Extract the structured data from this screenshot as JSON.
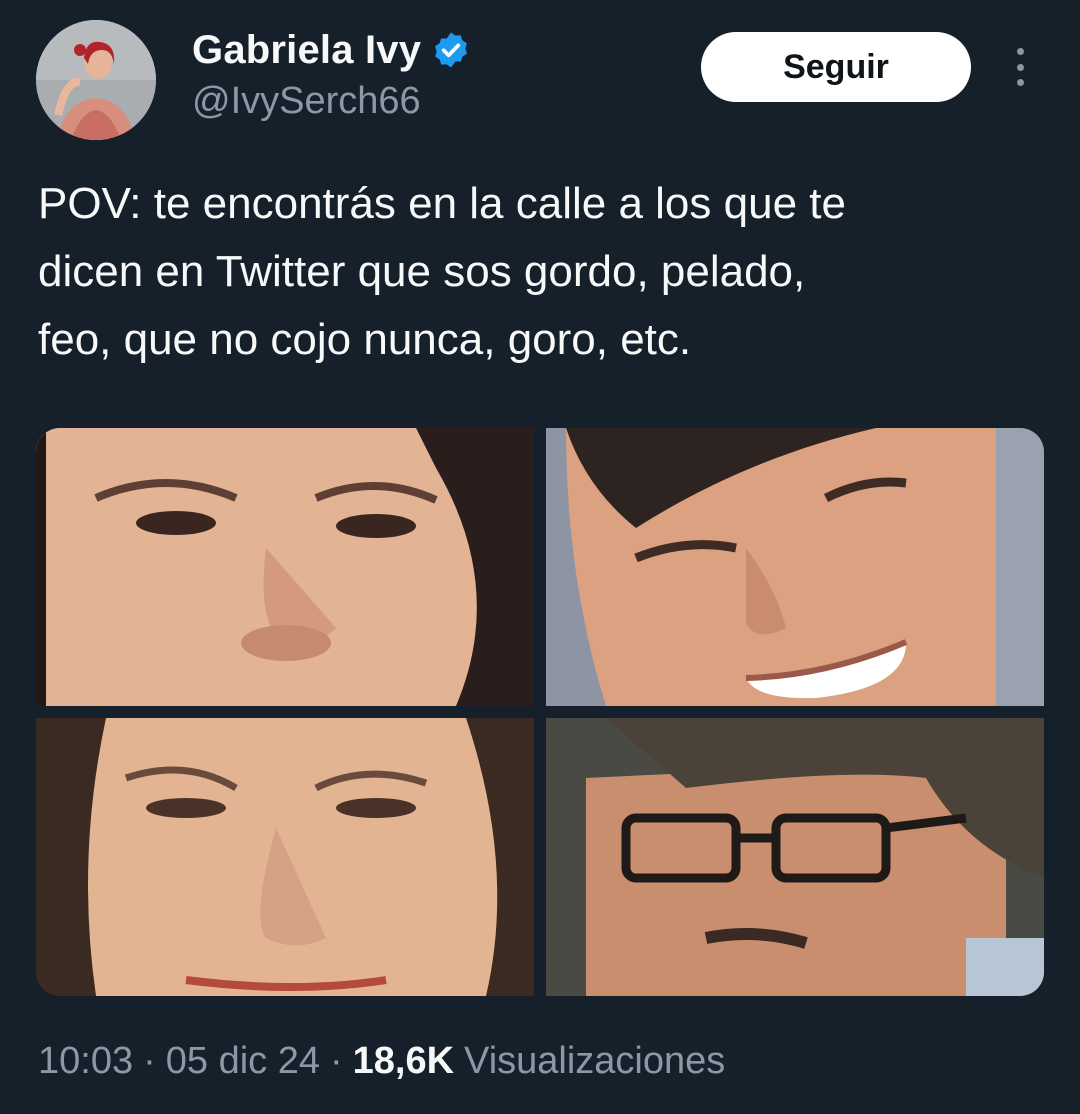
{
  "author": {
    "display_name": "Gabriela Ivy",
    "handle": "@IvySerch66",
    "verified": true,
    "avatar": "avatar-photo"
  },
  "header": {
    "follow_label": "Seguir",
    "more_icon": "more-vertical-icon"
  },
  "tweet": {
    "text": "POV: te encontrás en la calle a los que te\ndicen en Twitter que sos gordo, pelado,\nfeo, que no cojo nunca, goro, etc."
  },
  "media": [
    {
      "kind": "photo"
    },
    {
      "kind": "photo"
    },
    {
      "kind": "photo"
    },
    {
      "kind": "photo"
    }
  ],
  "meta": {
    "time": "10:03",
    "separator": "·",
    "date": "05 dic 24",
    "views_count": "18,6K",
    "views_label": "Visualizaciones"
  },
  "colors": {
    "background": "#15202b",
    "primary_text": "#f7f9f9",
    "secondary_text": "#8b98a5",
    "verified_blue": "#1d9bf0",
    "follow_bg": "#ffffff"
  }
}
